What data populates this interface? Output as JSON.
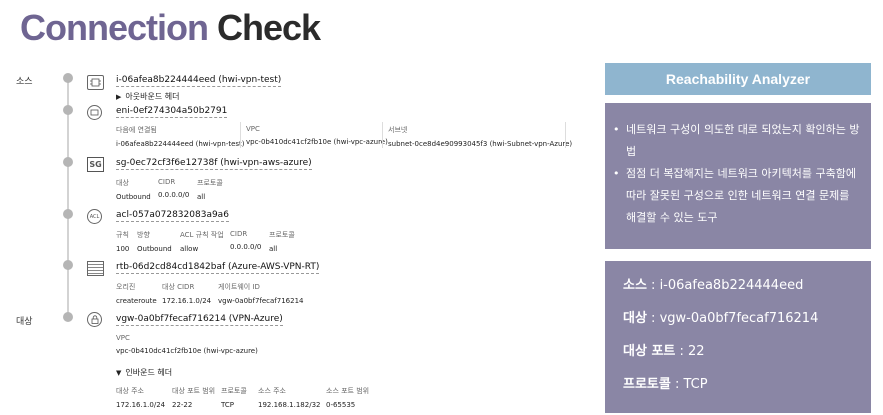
{
  "title": {
    "part1": "Connection",
    "part2": "Check"
  },
  "side_labels": {
    "source": "소스",
    "destination": "대상"
  },
  "nodes": {
    "instance": {
      "id": "i-06afea8b224444eed (hwi-vpn-test)",
      "toggle": "아웃바운드 헤더"
    },
    "eni": {
      "id": "eni-0ef274304a50b2791",
      "attached_to_label": "다음에 연결됨",
      "attached_to_value": "i-06afea8b224444eed (hwi-vpn-test)",
      "vpc_label": "VPC",
      "vpc_value": "vpc-0b410dc41cf2fb10e (hwi-vpc-azure)",
      "subnet_label": "서브넷",
      "subnet_value": "subnet-0ce8d4e90993045f3 (hwi-Subnet-vpn-Azure)"
    },
    "sg": {
      "icon_text": "SG",
      "id": "sg-0ec72cf3f6e12738f (hwi-vpn-aws-azure)",
      "headers": [
        "대상",
        "CIDR",
        "프로토콜"
      ],
      "values": [
        "Outbound",
        "0.0.0.0/0",
        "all"
      ]
    },
    "acl": {
      "icon_text": "ACL",
      "id": "acl-057a072832083a9a6",
      "headers": [
        "규칙",
        "방향",
        "ACL 규칙 작업",
        "CIDR",
        "프로토콜"
      ],
      "values": [
        "100",
        "Outbound",
        "allow",
        "0.0.0.0/0",
        "all"
      ]
    },
    "rtb": {
      "id": "rtb-06d2cd84cd1842baf (Azure-AWS-VPN-RT)",
      "headers": [
        "오리진",
        "대상 CIDR",
        "게이트웨이 ID"
      ],
      "values": [
        "createroute",
        "172.16.1.0/24",
        "vgw-0a0bf7fecaf716214"
      ]
    },
    "vgw": {
      "id": "vgw-0a0bf7fecaf716214 (VPN-Azure)",
      "vpc_label": "VPC",
      "vpc_value": "vpc-0b410dc41cf2fb10e (hwi-vpc-azure)",
      "toggle": "인바운드 헤더",
      "headers": [
        "대상 주소",
        "대상 포트 범위",
        "프로토콜",
        "소스 주소",
        "소스 포트 범위"
      ],
      "values": [
        "172.16.1.0/24",
        "22-22",
        "TCP",
        "192.168.1.182/32",
        "0-65535"
      ]
    }
  },
  "panel": {
    "header": "Reachability Analyzer",
    "bullets": [
      "네트워크 구성이 의도한 대로 되었는지 확인하는 방법",
      "점점 더 복잡해지는 네트워크 아키텍처를 구축함에 따라 잘못된 구성으로 인한 네트워크 연결 문제를 해결할 수 있는 도구"
    ],
    "info": [
      {
        "label": "소스",
        "value": " : i-06afea8b224444eed"
      },
      {
        "label": "대상",
        "value": " : vgw-0a0bf7fecaf716214"
      },
      {
        "label": "대상 포트",
        "value": " : 22"
      },
      {
        "label": "프로토콜",
        "value": " : TCP"
      }
    ]
  },
  "colors": {
    "title_accent": "#6f6592",
    "header_bg": "#8fb5cf",
    "panel_bg": "#8a86a5"
  },
  "icons": {
    "instance": "chip-icon",
    "eni": "network-interface-icon",
    "sg": "security-group-icon",
    "acl": "network-acl-icon",
    "rtb": "route-table-icon",
    "vgw": "vpn-gateway-icon"
  }
}
